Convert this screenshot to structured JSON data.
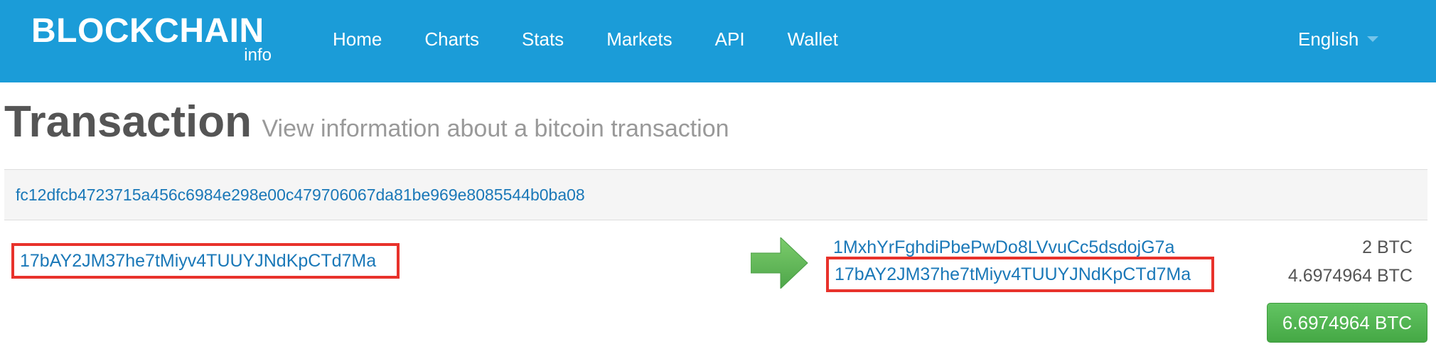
{
  "nav": {
    "logo": "BLOCKCHAIN",
    "logo_sub": "info",
    "items": [
      "Home",
      "Charts",
      "Stats",
      "Markets",
      "API",
      "Wallet"
    ],
    "language": "English"
  },
  "page": {
    "title": "Transaction",
    "subtitle": "View information about a bitcoin transaction"
  },
  "transaction": {
    "hash": "fc12dfcb4723715a456c6984e298e00c479706067da81be969e8085544b0ba08",
    "inputs": [
      {
        "address": "17bAY2JM37he7tMiyv4TUUYJNdKpCTd7Ma"
      }
    ],
    "outputs": [
      {
        "address": "1MxhYrFghdiPbePwDo8LVvuCc5dsdojG7a",
        "amount": "2 BTC"
      },
      {
        "address": "17bAY2JM37he7tMiyv4TUUYJNdKpCTd7Ma",
        "amount": "4.6974964 BTC"
      }
    ],
    "total": "6.6974964 BTC"
  },
  "colors": {
    "navbar": "#1b9cd8",
    "link": "#1a78b8",
    "highlight_border": "#e8322b",
    "arrow_green": "#5cb85c",
    "total_button": "#52b752"
  },
  "icons": {
    "arrow": "right-arrow-icon",
    "caret": "chevron-down-icon"
  }
}
